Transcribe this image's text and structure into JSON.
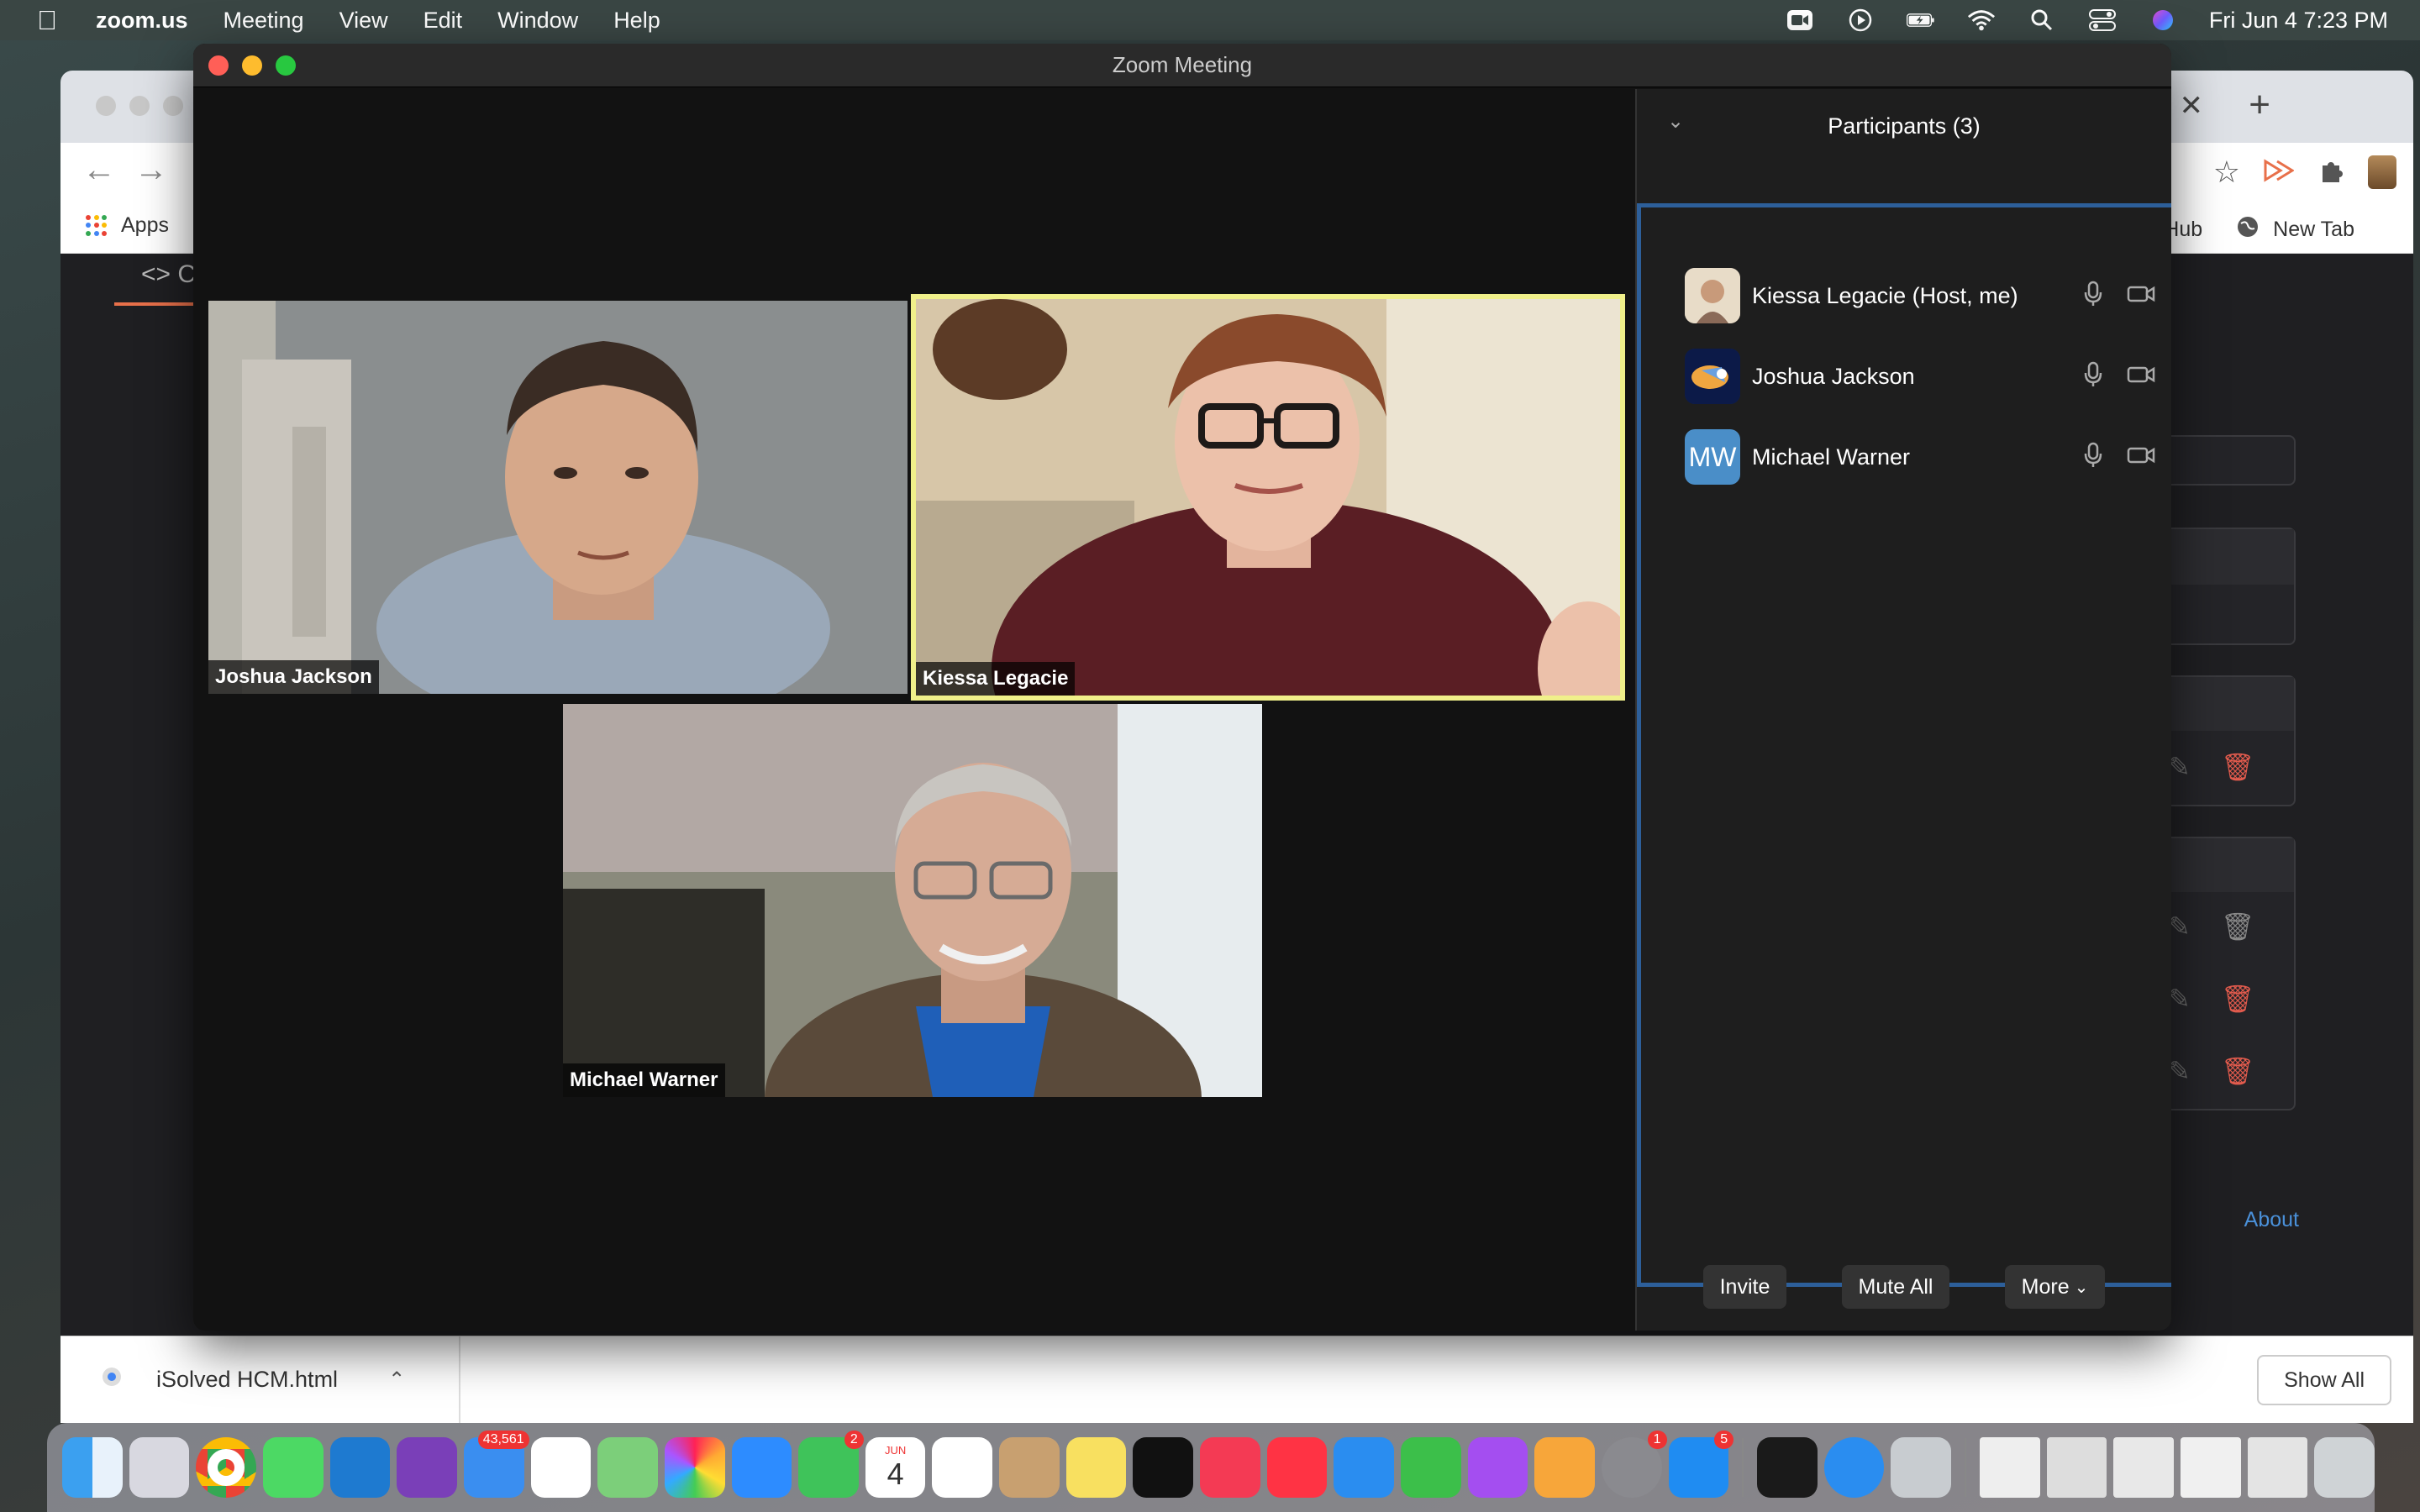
{
  "menubar": {
    "app_name": "zoom.us",
    "items": [
      "Meeting",
      "View",
      "Edit",
      "Window",
      "Help"
    ],
    "clock": "Fri Jun 4  7:23 PM"
  },
  "chrome": {
    "bookmarks": {
      "apps_label": "Apps",
      "github_fragment": "tHub",
      "new_tab_label": "New Tab"
    },
    "code_tab_fragment": "C",
    "about_link": "About",
    "download": {
      "filename": "iSolved HCM.html",
      "show_all": "Show All"
    }
  },
  "zoom": {
    "window_title": "Zoom Meeting",
    "tiles": [
      {
        "name": "Joshua Jackson",
        "active": false
      },
      {
        "name": "Kiessa Legacie",
        "active": true
      },
      {
        "name": "Michael Warner",
        "active": false
      }
    ],
    "participants": {
      "title": "Participants (3)",
      "list": [
        {
          "name": "Kiessa Legacie (Host, me)",
          "initials": ""
        },
        {
          "name": "Joshua Jackson",
          "initials": ""
        },
        {
          "name": "Michael Warner",
          "initials": "MW"
        }
      ],
      "buttons": {
        "invite": "Invite",
        "mute_all": "Mute All",
        "more": "More"
      }
    }
  },
  "dock": {
    "badges": {
      "mail": "43,561",
      "facetime": "2",
      "calendar_month": "JUN",
      "calendar_day": "4",
      "sysprefs": "1",
      "appstore": "5"
    }
  }
}
